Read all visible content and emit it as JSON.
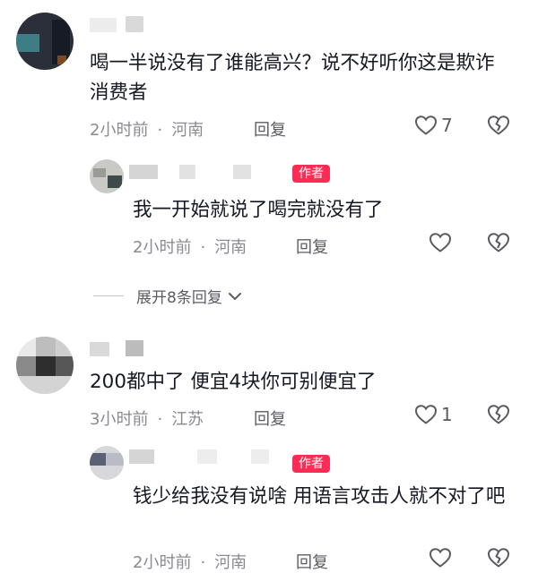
{
  "comments": [
    {
      "text": "喝一半说没有了谁能高兴？说不好听你这是欺诈消费者",
      "time": "2小时前",
      "location": "河南",
      "reply_label": "回复",
      "likes": "7"
    },
    {
      "text": "200都中了 便宜4块你可别便宜了",
      "time": "3小时前",
      "location": "江苏",
      "reply_label": "回复",
      "likes": "1"
    }
  ],
  "replies": [
    {
      "badge": "作者",
      "text": "我一开始就说了喝完就没有了",
      "time": "2小时前",
      "location": "河南",
      "reply_label": "回复"
    },
    {
      "badge": "作者",
      "text": "钱少给我没有说啥 用语言攻击人就不对了吧",
      "time": "2小时前",
      "location": "河南",
      "reply_label": "回复"
    }
  ],
  "expand_label": "展开8条回复",
  "colors": {
    "badge": "#fe2c55",
    "meta": "#8a8b91",
    "text": "#161823"
  }
}
